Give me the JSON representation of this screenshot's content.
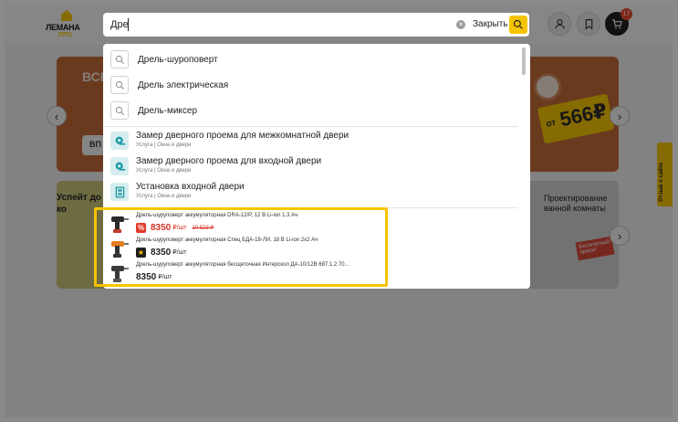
{
  "logo": {
    "name": "ЛЕМАНА",
    "sub": "ПРО"
  },
  "header": {
    "cart_count": "17"
  },
  "search": {
    "value": "Дре",
    "close_label": "Закрыть"
  },
  "suggestions": [
    {
      "label": "Дрель-шуроповерт"
    },
    {
      "label": "Дрель электрическая"
    },
    {
      "label": "Дрель-миксер"
    }
  ],
  "services": [
    {
      "title": "Замер дверного проема для межкомнатной двери",
      "category": "Услуга | Окна и двери"
    },
    {
      "title": "Замер дверного проема для входной двери",
      "category": "Услуга | Окна и двери"
    },
    {
      "title": "Установка входной двери",
      "category": "Услуга | Окна и двери"
    }
  ],
  "products": [
    {
      "name": "Дрель-шуруповерт аккумуляторная DRA-12/P, 12 В Li-ion 1.3 Ач",
      "price": "8350",
      "unit": "₽/шт",
      "old_price": "10 523 ₽",
      "tag": "%"
    },
    {
      "name": "Дрель-шуруповерт аккумуляторная Спец БДА-18-ЛИ, 18 В Li-ion 2x2 Ач",
      "price": "8350",
      "unit": "₽/шт",
      "tag": "★"
    },
    {
      "name": "Дрель-шуруповерт аккумуляторная бесщеточная Интерскол ДА-10/12В 687.1.2.70...",
      "price": "8350",
      "unit": "₽/шт"
    }
  ],
  "background": {
    "banner_orange_text": "ВСЕ",
    "banner_orange_button": "ВП",
    "price_prefix": "от",
    "price_value": "566₽",
    "banner_left_text": "Успейт до ко",
    "banner_right_text": "Проектирование ванной комнаты",
    "stamp_text": "Бесплатный проект",
    "feedback": "Отзыв о сайте"
  },
  "colors": {
    "accent": "#f5c400",
    "sale": "#d93025",
    "banner": "#c26a3a"
  }
}
